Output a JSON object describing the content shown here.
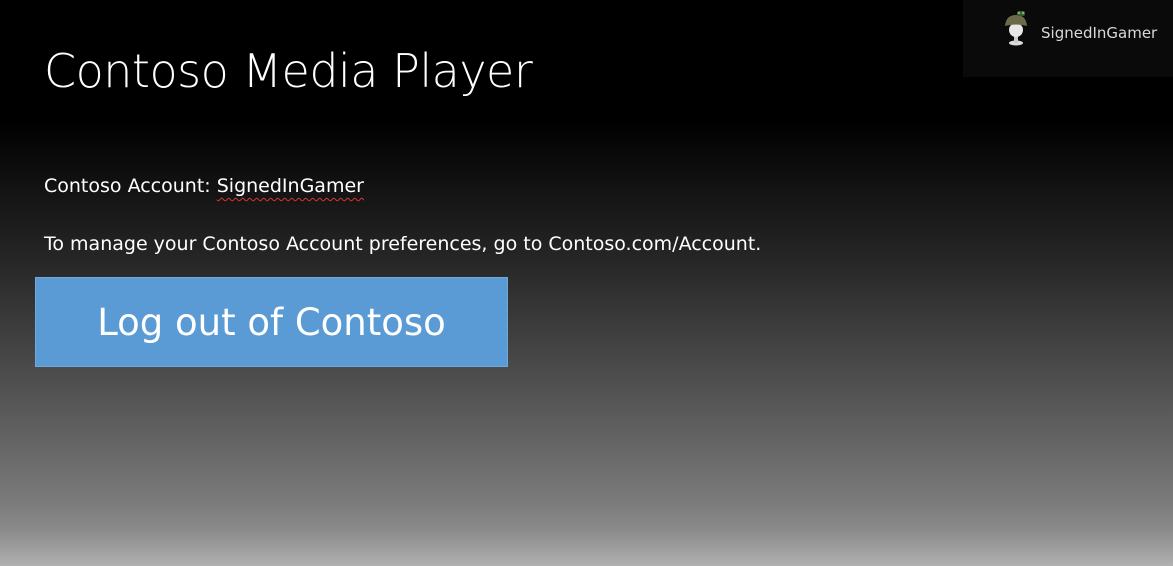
{
  "app": {
    "title": "Contoso Media Player"
  },
  "account": {
    "label": "Contoso Account:",
    "username": "SignedInGamer"
  },
  "manage_text": "To manage your Contoso Account preferences, go to Contoso.com/Account.",
  "logout_button": {
    "label": "Log out of Contoso",
    "color": "#5b9bd5"
  },
  "gamer_tag": {
    "name": "SignedInGamer",
    "avatar_icon": "helmet-avatar-icon"
  }
}
